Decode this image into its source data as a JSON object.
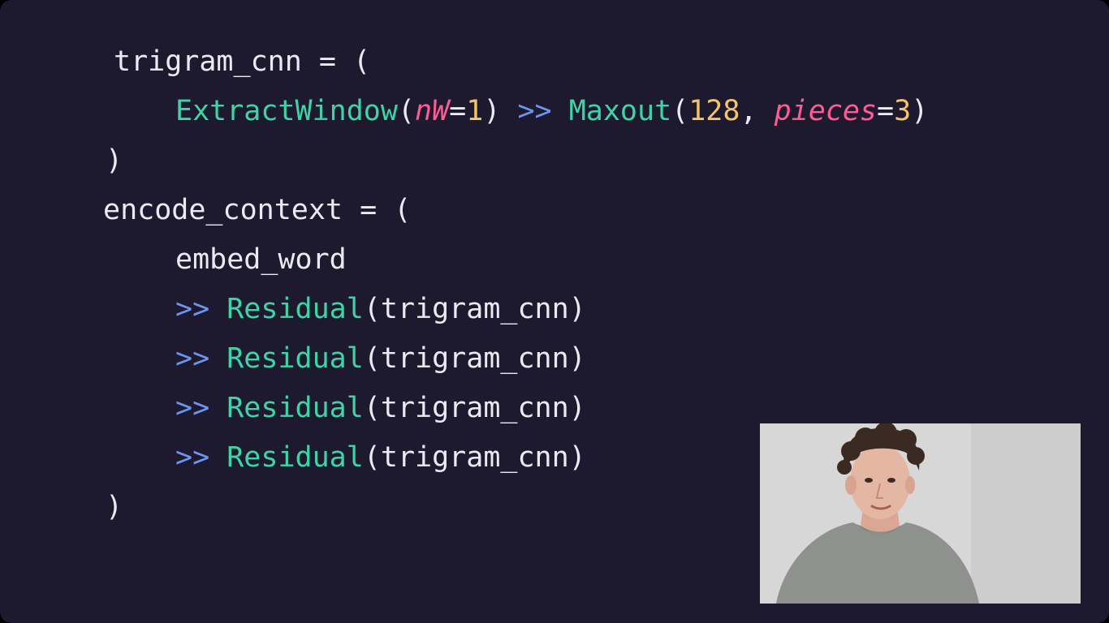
{
  "code": {
    "line1": {
      "name": "trigram_cnn",
      "rest": " = ("
    },
    "line2": {
      "fn1": "ExtractWindow",
      "open1": "(",
      "kw1": "nW",
      "eq1": "=",
      "num1": "1",
      "close1": ")",
      "op": ">>",
      "fn2": "Maxout",
      "open2": "(",
      "num2": "128",
      "comma": ",",
      "kw2": "pieces",
      "eq2": "=",
      "num3": "3",
      "close2": ")"
    },
    "line3": ")",
    "line4": {
      "name": "encode_context",
      "rest": " = ("
    },
    "line5": "embed_word",
    "residual_lines": [
      {
        "op": ">>",
        "fn": "Residual",
        "arg": "(trigram_cnn)"
      },
      {
        "op": ">>",
        "fn": "Residual",
        "arg": "(trigram_cnn)"
      },
      {
        "op": ">>",
        "fn": "Residual",
        "arg": "(trigram_cnn)"
      },
      {
        "op": ">>",
        "fn": "Residual",
        "arg": "(trigram_cnn)"
      }
    ],
    "line10": ")"
  },
  "colors": {
    "background": "#1d1a2f",
    "function": "#3ed4a5",
    "keyword": "#ff5c93",
    "number": "#f5c46a",
    "operator": "#6d95f0",
    "text": "#ece9f3"
  }
}
